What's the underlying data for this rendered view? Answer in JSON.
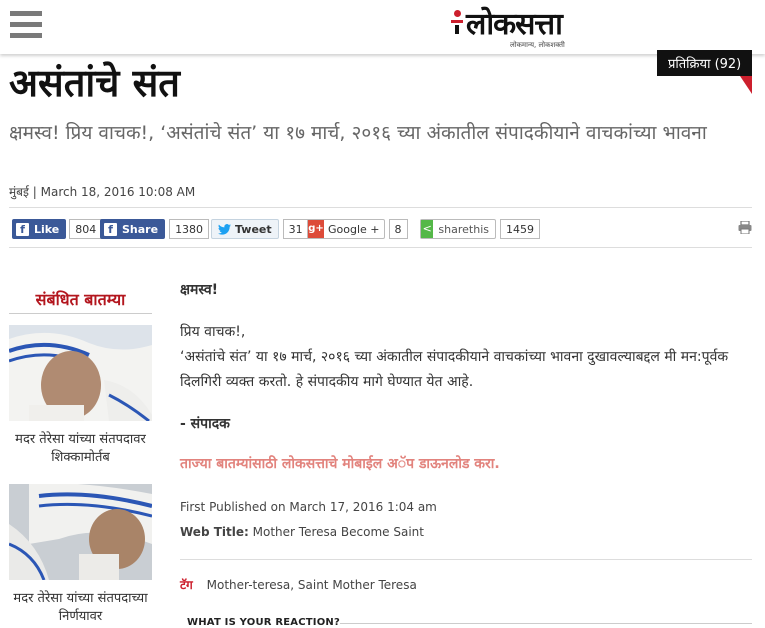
{
  "header": {
    "logo_text": "लोकसत्ता",
    "logo_tagline": "लोकमान्य, लोकशक्ती",
    "reactions_label": "प्रतिक्रिया (92)"
  },
  "article": {
    "title": "असंतांचे संत",
    "subtitle": "क्षमस्व! प्रिय वाचक!, ‘असंतांचे संत’ या १७ मार्च, २०१६ च्या अंकातील संपादकीयाने वाचकांच्या भावना",
    "location": "मुंबई",
    "separator": "|",
    "date": "March 18, 2016 10:08 AM"
  },
  "share": {
    "facebook_like_label": "Like",
    "facebook_like_count": "804",
    "facebook_share_label": "Share",
    "facebook_share_count": "1380",
    "tweet_label": "Tweet",
    "tweet_count": "31",
    "google_label": "Google +",
    "google_count": "8",
    "sharethis_label": "sharethis",
    "sharethis_count": "1459"
  },
  "sidebar": {
    "heading": "संबंधित बातम्या",
    "items": [
      {
        "caption": "मदर तेरेसा यांच्या संतपदावर शिक्कामोर्तब"
      },
      {
        "caption": "मदर तेरेसा यांच्या संतपदाच्या निर्णयावर"
      }
    ]
  },
  "body": {
    "greeting": "क्षमस्व!",
    "salutation": "प्रिय वाचक!,",
    "paragraph": "‘असंतांचे संत’ या १७ मार्च, २०१६ च्या अंकातील संपादकीयाने वाचकांच्या भावना दुखावल्याबद्दल मी मन:पूर्वक दिलगिरी व्यक्त करतो. हे संपादकीय मागे घेण्यात येत आहे.",
    "signature": "- संपादक",
    "app_promo": "ताज्या बातम्यांसाठी लोकसत्ताचे मोबाईल अॅप डाऊनलोड करा.",
    "first_published": "First Published on March 17, 2016 1:04 am",
    "web_title_label": "Web Title:",
    "web_title": "Mother Teresa Become Saint"
  },
  "tags": {
    "label": "टॅग",
    "values": "Mother-teresa, Saint Mother Teresa"
  },
  "reaction_heading": "WHAT IS YOUR REACTION?",
  "colors": {
    "brand_red": "#cc1f2d",
    "facebook_blue": "#3b5998",
    "promo_pink": "#e2837d"
  },
  "icons": [
    "hamburger-menu-icon",
    "facebook-icon",
    "twitter-icon",
    "google-plus-icon",
    "sharethis-icon",
    "print-icon"
  ]
}
